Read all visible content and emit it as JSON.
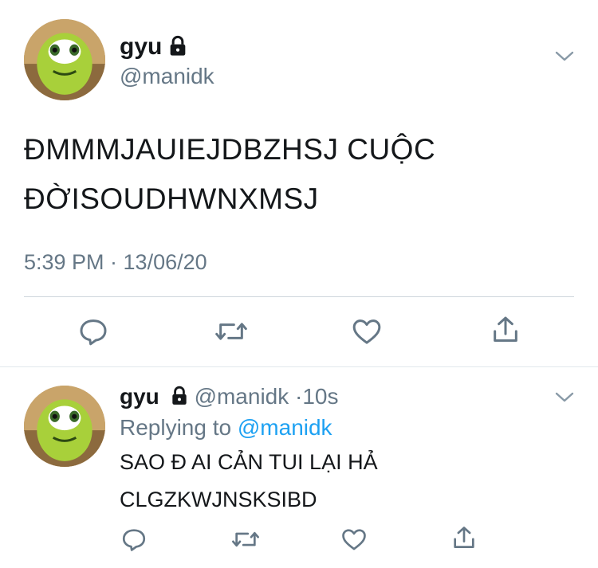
{
  "tweet": {
    "display_name": "gyu",
    "handle": "@manidk",
    "text_line1": "ĐMMMJAUIEJDBZHSJ CUỘC",
    "text_line2": "ĐỜISOUDHWNXMSJ",
    "timestamp": "5:39 PM · 13/06/20",
    "avatar_icon": "mike-wazowski-avatar",
    "lock_icon": "lock-icon",
    "menu_icon": "chevron-down-icon",
    "actions": [
      "reply-icon",
      "retweet-icon",
      "like-icon",
      "share-icon"
    ]
  },
  "reply": {
    "display_name": "gyu",
    "handle": "@manidk",
    "dot": "·",
    "time_ago": "10s",
    "replying_prefix": "Replying to",
    "replying_handle": "@manidk",
    "text_line1": "SAO Đ AI CẢN TUI LẠI HẢ",
    "text_line2": "CLGZKWJNSKSIBD",
    "actions": [
      "reply-icon",
      "retweet-icon",
      "like-icon",
      "share-icon"
    ]
  },
  "colors": {
    "text": "#14171a",
    "secondary": "#657786",
    "link": "#1da1f2",
    "divider": "#cfd6dc"
  }
}
